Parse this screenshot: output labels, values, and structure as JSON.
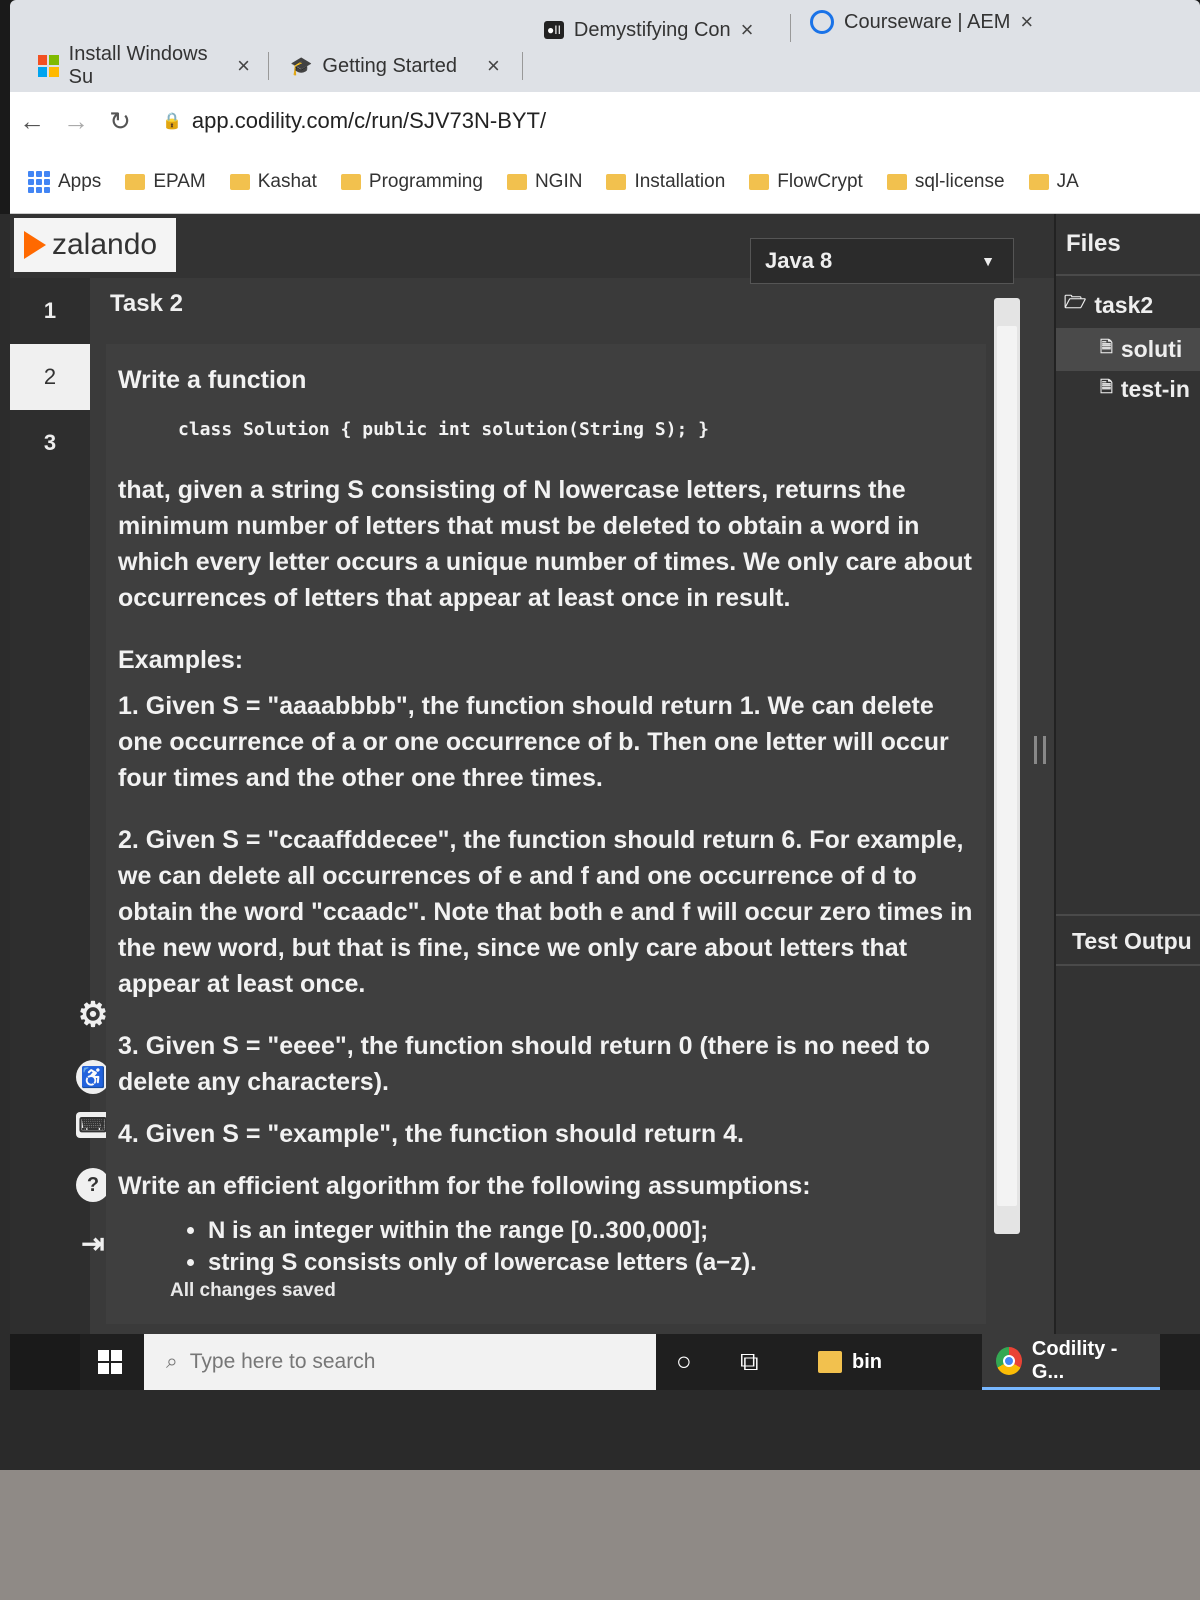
{
  "browser": {
    "tabs": [
      {
        "title": "Install Windows Su"
      },
      {
        "title": "Getting Started"
      },
      {
        "title": "Demystifying Con"
      },
      {
        "title": "Courseware | AEM"
      }
    ],
    "url": "app.codility.com/c/run/SJV73N-BYT/",
    "bookmarks": [
      "Apps",
      "EPAM",
      "Kashat",
      "Programming",
      "NGIN",
      "Installation",
      "FlowCrypt",
      "sql-license",
      "JA"
    ]
  },
  "app": {
    "logo_text": "zalando",
    "task_numbers": [
      "1",
      "2",
      "3"
    ],
    "task_title": "Task 2",
    "language": "Java 8",
    "status": "All changes saved"
  },
  "task": {
    "heading": "Write a function",
    "signature": "class Solution { public int solution(String S); }",
    "intro": "that, given a string S consisting of N lowercase letters, returns the minimum number of letters that must be deleted to obtain a word in which every letter occurs a unique number of times. We only care about occurrences of letters that appear at least once in result.",
    "examples_label": "Examples:",
    "examples": [
      "1. Given S = \"aaaabbbb\", the function should return 1. We can delete one occurrence of a or one occurrence of b. Then one letter will occur four times and the other one three times.",
      "2. Given S = \"ccaaffddecee\", the function should return 6. For example, we can delete all occurrences of e and f and one occurrence of d to obtain the word \"ccaadc\". Note that both e and f will occur zero times in the new word, but that is fine, since we only care about letters that appear at least once.",
      "3. Given S = \"eeee\", the function should return 0 (there is no need to delete any characters).",
      "4. Given S = \"example\", the function should return 4."
    ],
    "assumptions_label": "Write an efficient algorithm for the following assumptions:",
    "assumptions": [
      "N is an integer within the range [0..300,000];",
      "string S consists only of lowercase letters (a−z)."
    ]
  },
  "files": {
    "title": "Files",
    "folder": "task2",
    "items": [
      "soluti",
      "test-in"
    ],
    "test_output": "Test Outpu"
  },
  "taskbar": {
    "search_placeholder": "Type here to search",
    "folder_app": "bin",
    "chrome_app": "Codility - G..."
  }
}
